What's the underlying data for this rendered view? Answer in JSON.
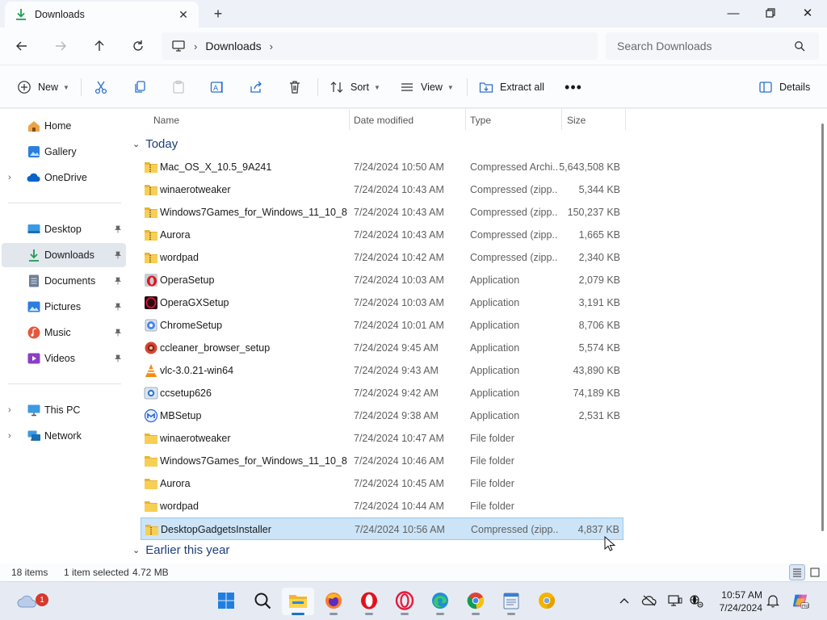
{
  "window": {
    "tab_title": "Downloads",
    "controls": {
      "minimize": "—",
      "maximize": "▢",
      "close": "✕"
    }
  },
  "address": {
    "breadcrumb": [
      "Downloads"
    ],
    "search_placeholder": "Search Downloads"
  },
  "commands": {
    "new": "New",
    "sort": "Sort",
    "view": "View",
    "extract_all": "Extract all",
    "details": "Details"
  },
  "nav": {
    "quick": [
      {
        "label": "Home",
        "icon": "home-icon"
      },
      {
        "label": "Gallery",
        "icon": "gallery-icon"
      },
      {
        "label": "OneDrive",
        "icon": "onedrive-icon"
      }
    ],
    "pinned": [
      {
        "label": "Desktop",
        "icon": "desktop-icon"
      },
      {
        "label": "Downloads",
        "icon": "downloads-icon",
        "selected": true
      },
      {
        "label": "Documents",
        "icon": "documents-icon"
      },
      {
        "label": "Pictures",
        "icon": "pictures-icon"
      },
      {
        "label": "Music",
        "icon": "music-icon"
      },
      {
        "label": "Videos",
        "icon": "videos-icon"
      }
    ],
    "devices": [
      {
        "label": "This PC",
        "icon": "this-pc-icon"
      },
      {
        "label": "Network",
        "icon": "network-icon"
      }
    ]
  },
  "columns": {
    "name": "Name",
    "date": "Date modified",
    "type": "Type",
    "size": "Size"
  },
  "groups": {
    "today": "Today",
    "earlier": "Earlier this year"
  },
  "files": [
    {
      "name": "Mac_OS_X_10.5_9A241",
      "date": "7/24/2024 10:50 AM",
      "type": "Compressed Archi...",
      "size": "5,643,508 KB",
      "icon": "zip-folder-icon"
    },
    {
      "name": "winaerotweaker",
      "date": "7/24/2024 10:43 AM",
      "type": "Compressed (zipp...",
      "size": "5,344 KB",
      "icon": "zip-folder-icon"
    },
    {
      "name": "Windows7Games_for_Windows_11_10_8",
      "date": "7/24/2024 10:43 AM",
      "type": "Compressed (zipp...",
      "size": "150,237 KB",
      "icon": "zip-folder-icon"
    },
    {
      "name": "Aurora",
      "date": "7/24/2024 10:43 AM",
      "type": "Compressed (zipp...",
      "size": "1,665 KB",
      "icon": "zip-folder-icon"
    },
    {
      "name": "wordpad",
      "date": "7/24/2024 10:42 AM",
      "type": "Compressed (zipp...",
      "size": "2,340 KB",
      "icon": "zip-folder-icon"
    },
    {
      "name": "OperaSetup",
      "date": "7/24/2024 10:03 AM",
      "type": "Application",
      "size": "2,079 KB",
      "icon": "opera-setup-icon"
    },
    {
      "name": "OperaGXSetup",
      "date": "7/24/2024 10:03 AM",
      "type": "Application",
      "size": "3,191 KB",
      "icon": "opera-gx-icon"
    },
    {
      "name": "ChromeSetup",
      "date": "7/24/2024 10:01 AM",
      "type": "Application",
      "size": "8,706 KB",
      "icon": "chrome-setup-icon"
    },
    {
      "name": "ccleaner_browser_setup",
      "date": "7/24/2024 9:45 AM",
      "type": "Application",
      "size": "5,574 KB",
      "icon": "ccleaner-browser-icon"
    },
    {
      "name": "vlc-3.0.21-win64",
      "date": "7/24/2024 9:43 AM",
      "type": "Application",
      "size": "43,890 KB",
      "icon": "vlc-icon"
    },
    {
      "name": "ccsetup626",
      "date": "7/24/2024 9:42 AM",
      "type": "Application",
      "size": "74,189 KB",
      "icon": "ccleaner-setup-icon"
    },
    {
      "name": "MBSetup",
      "date": "7/24/2024 9:38 AM",
      "type": "Application",
      "size": "2,531 KB",
      "icon": "malwarebytes-icon"
    },
    {
      "name": "winaerotweaker",
      "date": "7/24/2024 10:47 AM",
      "type": "File folder",
      "size": "",
      "icon": "folder-icon"
    },
    {
      "name": "Windows7Games_for_Windows_11_10_8",
      "date": "7/24/2024 10:46 AM",
      "type": "File folder",
      "size": "",
      "icon": "folder-icon"
    },
    {
      "name": "Aurora",
      "date": "7/24/2024 10:45 AM",
      "type": "File folder",
      "size": "",
      "icon": "folder-icon"
    },
    {
      "name": "wordpad",
      "date": "7/24/2024 10:44 AM",
      "type": "File folder",
      "size": "",
      "icon": "folder-icon"
    },
    {
      "name": "DesktopGadgetsInstaller",
      "date": "7/24/2024 10:56 AM",
      "type": "Compressed (zipp...",
      "size": "4,837 KB",
      "icon": "zip-folder-icon",
      "selected": true
    }
  ],
  "status": {
    "count": "18 items",
    "selection": "1 item selected",
    "selection_size": "4.72 MB"
  },
  "taskbar": {
    "weather_badge": "1",
    "apps": [
      "start-icon",
      "search-icon",
      "file-explorer-icon",
      "firefox-icon",
      "opera-icon",
      "opera-gx-icon",
      "edge-icon",
      "chrome-icon",
      "notepad-icon",
      "chrome-canary-icon"
    ],
    "time": "10:57 AM",
    "date": "7/24/2024"
  },
  "colors": {
    "accent": "#0067c0",
    "selection": "#cce4f7",
    "folder": "#f5c34b"
  }
}
